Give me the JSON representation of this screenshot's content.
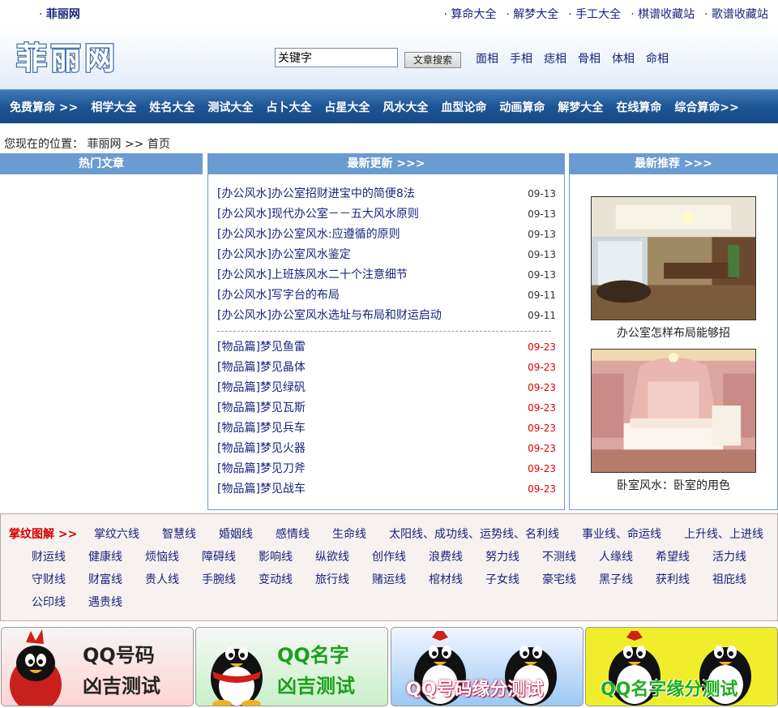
{
  "top": {
    "site_name": "菲丽网",
    "links": [
      "算命大全",
      "解梦大全",
      "手工大全",
      "棋谱收藏站",
      "歌谱收藏站"
    ]
  },
  "header": {
    "logo_text": "菲丽网",
    "search_value": "关键字",
    "search_button": "文章搜索",
    "links": [
      "面相",
      "手相",
      "痣相",
      "骨相",
      "体相",
      "命相"
    ]
  },
  "nav": [
    "免费算命 >>",
    "相学大全",
    "姓名大全",
    "测试大全",
    "占卜大全",
    "占星大全",
    "风水大全",
    "血型论命",
    "动画算命",
    "解梦大全",
    "在线算命",
    "综合算命>>"
  ],
  "breadcrumb": {
    "prefix": "您现在的位置：",
    "site": "菲丽网",
    "sep": ">>",
    "current": "首页"
  },
  "hot": {
    "title": "热门文章"
  },
  "latest": {
    "title": "最新更新 >>>",
    "group1": [
      {
        "title": "[办公风水]办公室招财进宝中的简便8法",
        "date": "09-13"
      },
      {
        "title": "[办公风水]现代办公室－－五大风水原则",
        "date": "09-13"
      },
      {
        "title": "[办公风水]办公室风水:应遵循的原则",
        "date": "09-13"
      },
      {
        "title": "[办公风水]办公室风水鉴定",
        "date": "09-13"
      },
      {
        "title": "[办公风水]上班族风水二十个注意细节",
        "date": "09-13"
      },
      {
        "title": "[办公风水]写字台的布局",
        "date": "09-11"
      },
      {
        "title": "[办公风水]办公室风水选址与布局和财运启动",
        "date": "09-11"
      }
    ],
    "group2": [
      {
        "title": "[物品篇]梦见鱼雷",
        "date": "09-23"
      },
      {
        "title": "[物品篇]梦见晶体",
        "date": "09-23"
      },
      {
        "title": "[物品篇]梦见绿矾",
        "date": "09-23"
      },
      {
        "title": "[物品篇]梦见瓦斯",
        "date": "09-23"
      },
      {
        "title": "[物品篇]梦见兵车",
        "date": "09-23"
      },
      {
        "title": "[物品篇]梦见火器",
        "date": "09-23"
      },
      {
        "title": "[物品篇]梦见刀斧",
        "date": "09-23"
      },
      {
        "title": "[物品篇]梦见战车",
        "date": "09-23"
      }
    ]
  },
  "recommend": {
    "title": "最新推荐 >>>",
    "items": [
      {
        "caption": "办公室怎样布局能够招"
      },
      {
        "caption": "卧室风水：卧室的用色"
      }
    ]
  },
  "palm": {
    "title": "掌纹图解 >>",
    "row1": [
      "掌纹六线",
      "智慧线",
      "婚姻线",
      "感情线",
      "生命线",
      "太阳线、成功线、运势线、名利线",
      "事业线、命运线",
      "上升线、上进线"
    ],
    "row2": [
      "财运线",
      "健康线",
      "烦恼线",
      "障碍线",
      "影响线",
      "纵欲线",
      "创作线",
      "浪费线",
      "努力线",
      "不测线",
      "人缘线",
      "希望线",
      "活力线"
    ],
    "row3": [
      "守财线",
      "财富线",
      "贵人线",
      "手腕线",
      "变动线",
      "旅行线",
      "赌运线",
      "棺材线",
      "子女线",
      "豪宅线",
      "黑子线",
      "获利线",
      "祖庇线"
    ],
    "row4": [
      "公印线",
      "遇贵线"
    ]
  },
  "banners": [
    {
      "line1": "QQ号码",
      "line2": "凶吉测试"
    },
    {
      "line1": "QQ名字",
      "line2": "凶吉测试"
    },
    {
      "line1": "QQ号码缘分测试"
    },
    {
      "line1": "QQ名字缘分测试"
    }
  ]
}
